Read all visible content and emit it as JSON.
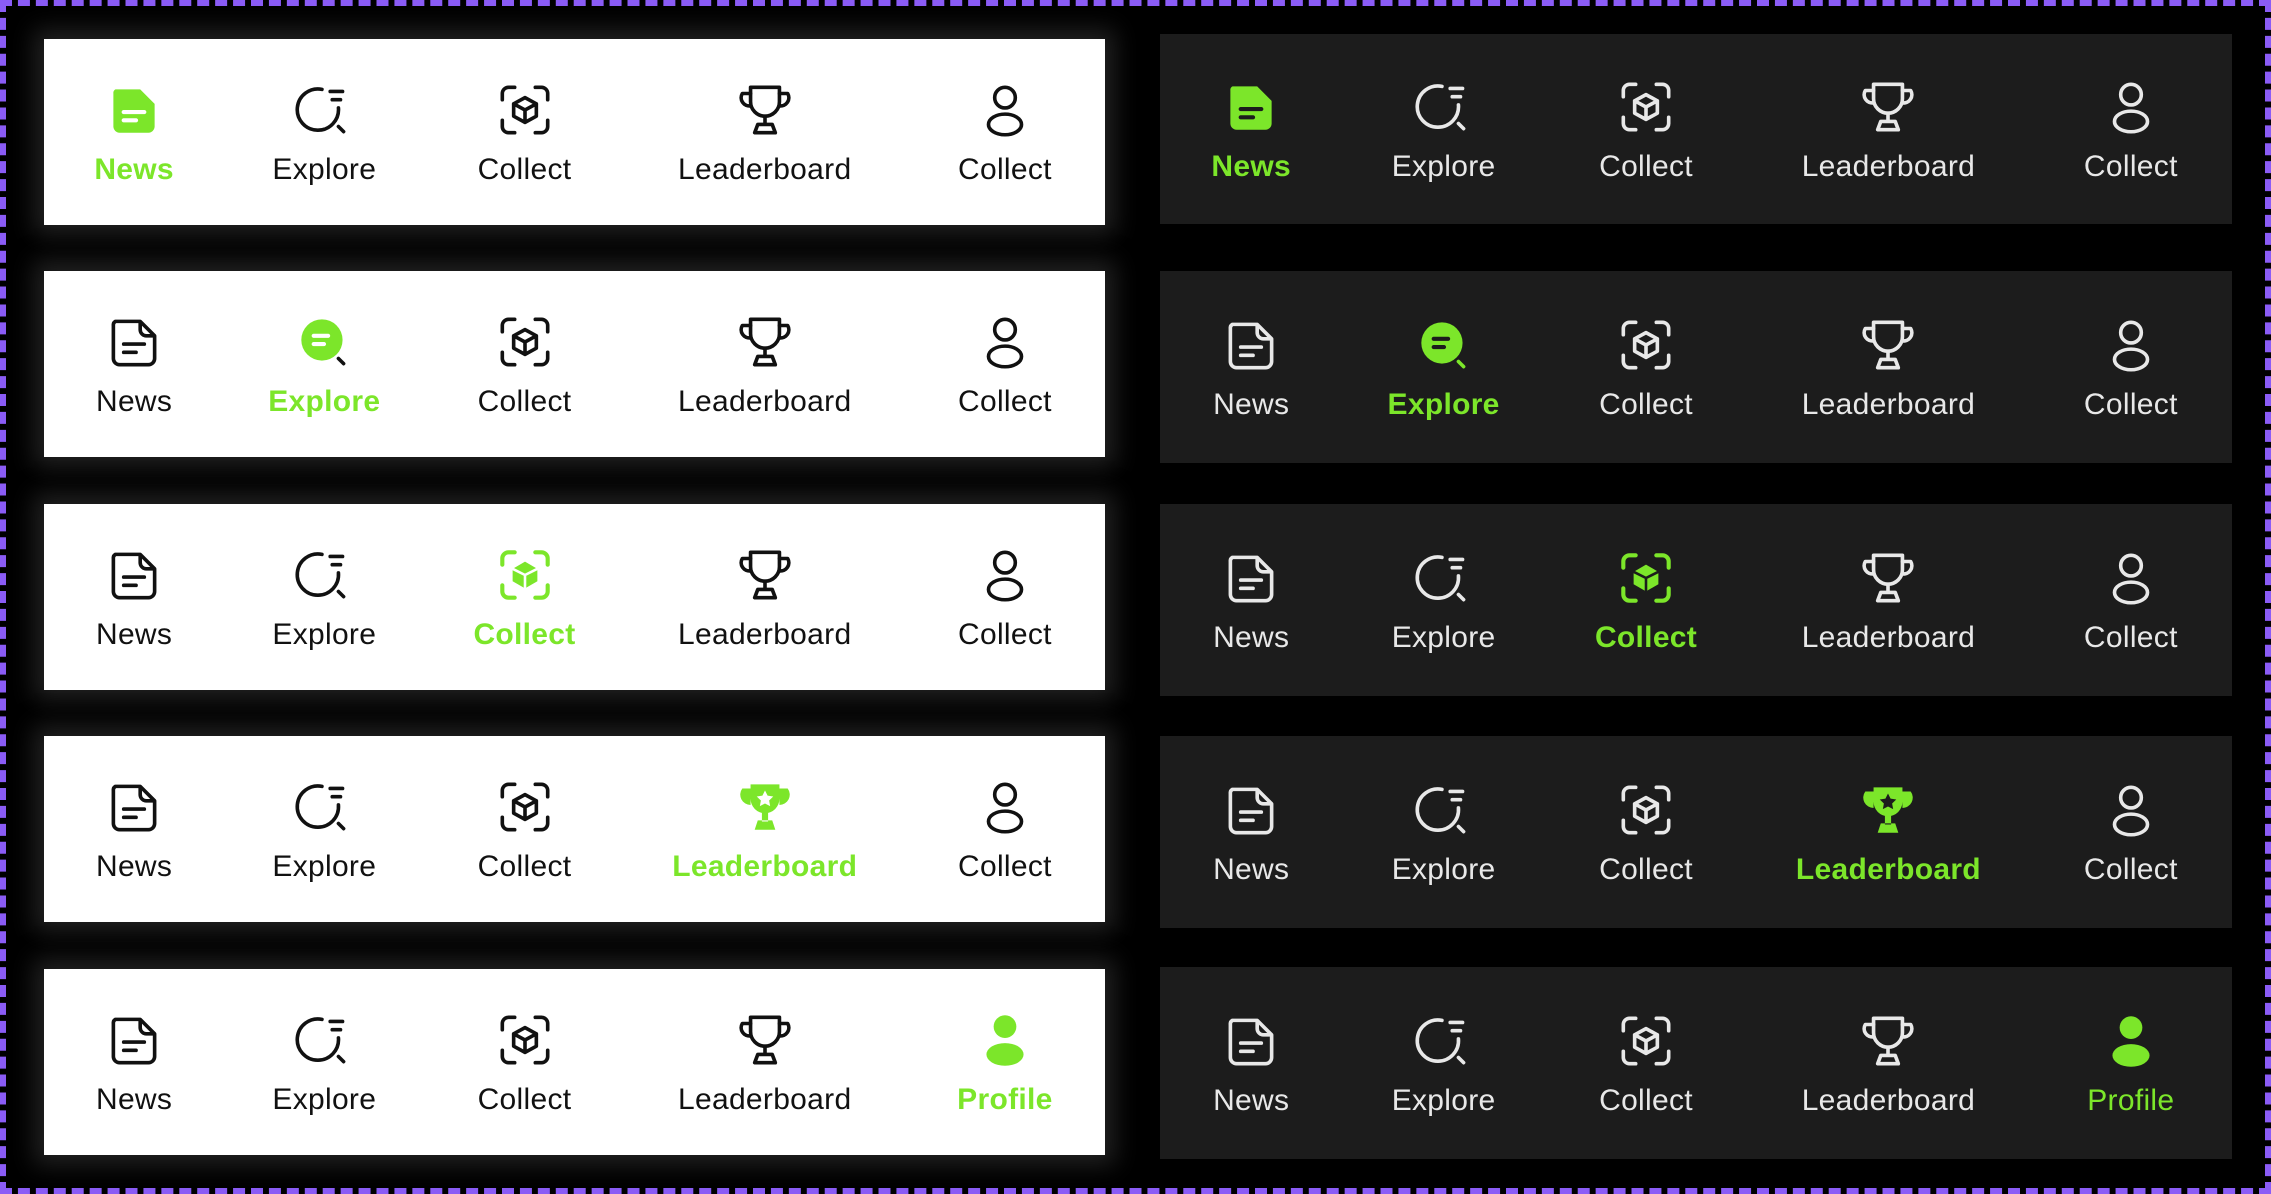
{
  "colors": {
    "accent": "#7ce62a",
    "light_bg": "#ffffff",
    "dark_bg": "#1c1c1c",
    "frame": "#8b5cf6"
  },
  "labels": {
    "news": "News",
    "explore": "Explore",
    "collect": "Collect",
    "leaderboard": "Leaderboard",
    "profile_collect": "Collect",
    "profile": "Profile"
  },
  "icons": [
    "news-icon",
    "explore-icon",
    "collect-icon",
    "leaderboard-icon",
    "profile-icon"
  ],
  "variants": [
    {
      "theme": "light",
      "active": "news"
    },
    {
      "theme": "light",
      "active": "explore"
    },
    {
      "theme": "light",
      "active": "collect"
    },
    {
      "theme": "light",
      "active": "leaderboard"
    },
    {
      "theme": "light",
      "active": "profile"
    },
    {
      "theme": "dark",
      "active": "news"
    },
    {
      "theme": "dark",
      "active": "explore"
    },
    {
      "theme": "dark",
      "active": "collect"
    },
    {
      "theme": "dark",
      "active": "leaderboard"
    },
    {
      "theme": "dark",
      "active": "profile"
    }
  ]
}
